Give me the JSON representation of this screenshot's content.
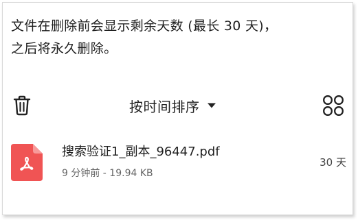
{
  "notice": {
    "line1": "文件在删除前会显示剩余天数 (最长 30 天)，",
    "line2": "之后将永久删除。"
  },
  "toolbar": {
    "delete_icon": "trash-icon",
    "sort_label": "按时间排序",
    "sort_icon": "caret-down-icon",
    "view_icon": "grid-view-icon"
  },
  "files": [
    {
      "name": "搜索验证1_副本_96447.pdf",
      "meta": "9 分钟前 - 19.94 KB",
      "remaining": "30 天",
      "icon": "pdf-file-icon"
    }
  ],
  "colors": {
    "pdf_icon": "#f05454",
    "text_primary": "#1f1f1f",
    "text_secondary": "#666666"
  }
}
